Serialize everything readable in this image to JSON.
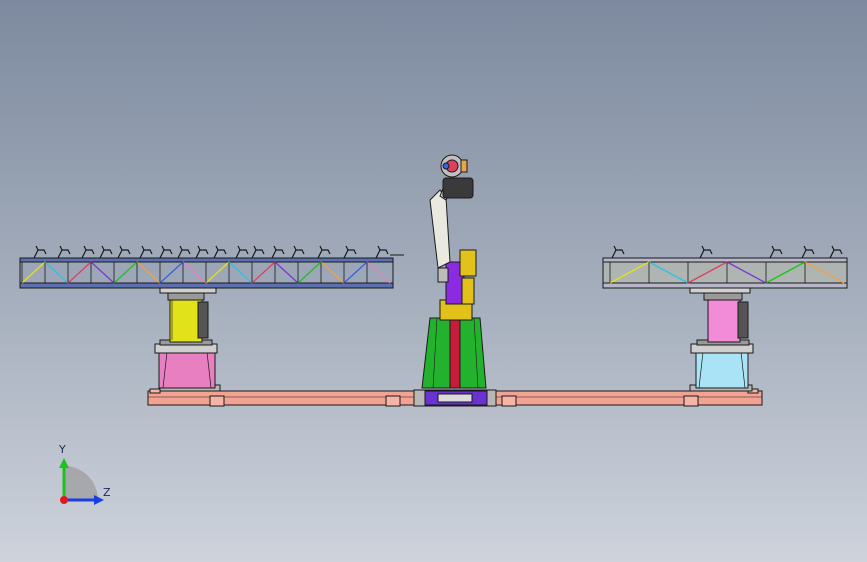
{
  "viewport": {
    "background_top": "#7d8a9f",
    "background_bottom": "#ced3dc"
  },
  "triad": {
    "y_label": "Y",
    "z_label": "Z",
    "y_color": "#1ec21e",
    "z_color": "#1a3fe0",
    "x_color": "#e01a1a"
  },
  "colors": {
    "base_rail": "#f2a392",
    "left_column_upper": "#e2e21a",
    "left_column_lower": "#e77fc1",
    "right_column_upper": "#f28bd8",
    "right_column_lower": "#a9e3f5",
    "robot_pedestal": "#22b22e",
    "robot_core": "#c81a3a",
    "robot_turret": "#8a2be2",
    "robot_arm": "#e9e9e0",
    "robot_head": "#3a3a3a",
    "outline": "#1a1a1a"
  }
}
